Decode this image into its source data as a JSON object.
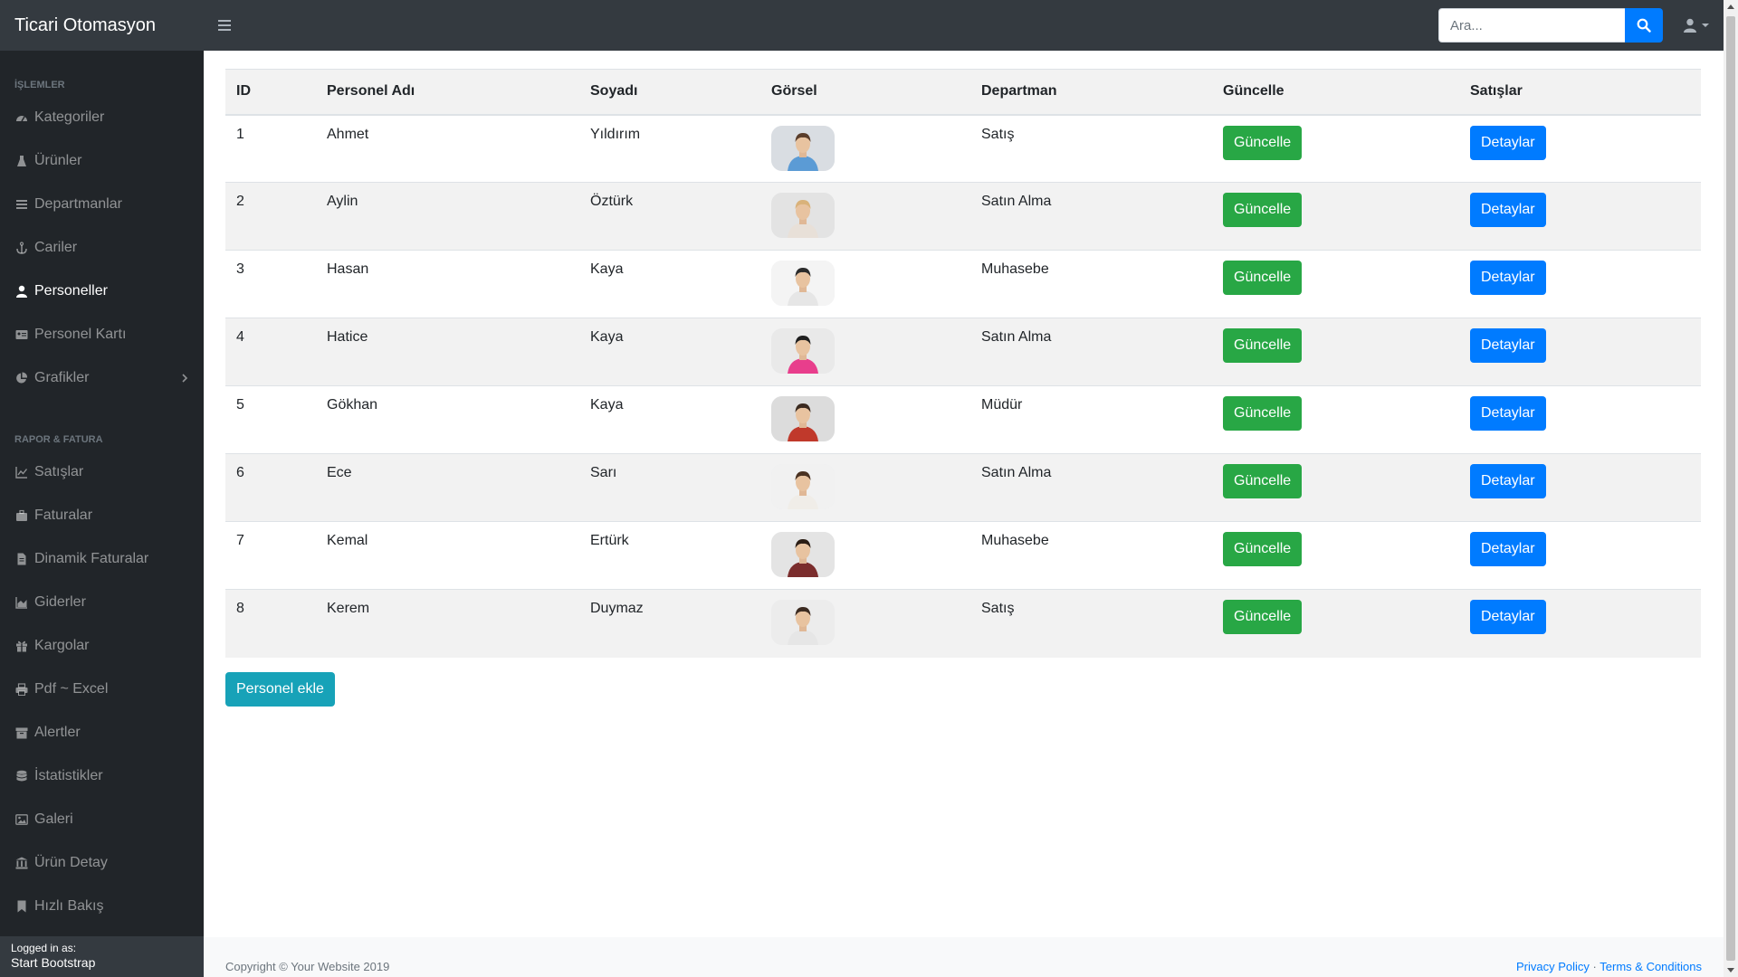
{
  "brand": "Ticari Otomasyon",
  "search": {
    "placeholder": "Ara..."
  },
  "sidebar": {
    "heading1": "İşlemler",
    "items1": [
      {
        "label": "Kategoriler",
        "icon": "tachometer-icon"
      },
      {
        "label": "Ürünler",
        "icon": "flask-icon"
      },
      {
        "label": "Departmanlar",
        "icon": "bars-icon"
      },
      {
        "label": "Cariler",
        "icon": "anchor-icon"
      },
      {
        "label": "Personeller",
        "icon": "user-icon",
        "active": true
      },
      {
        "label": "Personel Kartı",
        "icon": "id-card-icon"
      },
      {
        "label": "Grafikler",
        "icon": "chart-pie-icon"
      }
    ],
    "heading2": "Rapor & Fatura",
    "items2": [
      {
        "label": "Satışlar",
        "icon": "chart-line-icon"
      },
      {
        "label": "Faturalar",
        "icon": "briefcase-icon"
      },
      {
        "label": "Dinamik Faturalar",
        "icon": "file-icon"
      },
      {
        "label": "Giderler",
        "icon": "chart-area-icon"
      },
      {
        "label": "Kargolar",
        "icon": "gift-icon"
      },
      {
        "label": "Pdf ~ Excel",
        "icon": "print-icon"
      },
      {
        "label": "Alertler",
        "icon": "archive-icon"
      },
      {
        "label": "İstatistikler",
        "icon": "database-icon"
      },
      {
        "label": "Galeri",
        "icon": "image-icon"
      },
      {
        "label": "Ürün Detay",
        "icon": "landmark-icon"
      },
      {
        "label": "Hızlı Bakış",
        "icon": "bookmark-icon"
      }
    ],
    "footer_label": "Logged in as:",
    "footer_user": "Start Bootstrap"
  },
  "table": {
    "headers": [
      "ID",
      "Personel Adı",
      "Soyadı",
      "Görsel",
      "Departman",
      "Güncelle",
      "Satışlar"
    ],
    "rows": [
      {
        "id": "1",
        "name": "Ahmet",
        "surname": "Yıldırım",
        "dept": "Satış",
        "update": "Güncelle",
        "details": "Detaylar"
      },
      {
        "id": "2",
        "name": "Aylin",
        "surname": "Öztürk",
        "dept": "Satın Alma",
        "update": "Güncelle",
        "details": "Detaylar"
      },
      {
        "id": "3",
        "name": "Hasan",
        "surname": "Kaya",
        "dept": "Muhasebe",
        "update": "Güncelle",
        "details": "Detaylar"
      },
      {
        "id": "4",
        "name": "Hatice",
        "surname": "Kaya",
        "dept": "Satın Alma",
        "update": "Güncelle",
        "details": "Detaylar"
      },
      {
        "id": "5",
        "name": "Gökhan",
        "surname": "Kaya",
        "dept": "Müdür",
        "update": "Güncelle",
        "details": "Detaylar"
      },
      {
        "id": "6",
        "name": "Ece",
        "surname": "Sarı",
        "dept": "Satın Alma",
        "update": "Güncelle",
        "details": "Detaylar"
      },
      {
        "id": "7",
        "name": "Kemal",
        "surname": "Ertürk",
        "dept": "Muhasebe",
        "update": "Güncelle",
        "details": "Detaylar"
      },
      {
        "id": "8",
        "name": "Kerem",
        "surname": "Duymaz",
        "dept": "Satış",
        "update": "Güncelle",
        "details": "Detaylar"
      }
    ]
  },
  "add_button": "Personel ekle",
  "footer": {
    "copyright": "Copyright © Your Website 2019",
    "privacy": "Privacy Policy",
    "separator": "·",
    "terms": "Terms & Conditions"
  },
  "colors": {
    "navbar": "#343a40",
    "sidebar": "#212529",
    "primary": "#007bff",
    "success": "#28a745",
    "info": "#17a2b8"
  }
}
